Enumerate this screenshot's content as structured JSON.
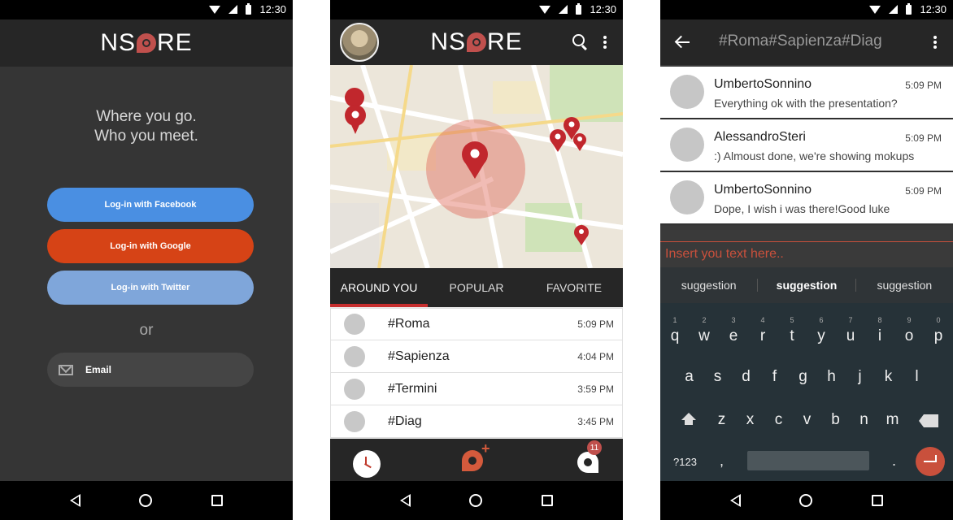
{
  "status": {
    "time": "12:30"
  },
  "brand": {
    "logo_left": "NS",
    "logo_right": "RE"
  },
  "screen1": {
    "tagline_1": "Where you go.",
    "tagline_2": "Who you meet.",
    "facebook_label": "Log-in with Facebook",
    "google_label": "Log-in with Google",
    "twitter_label": "Log-in with Twitter",
    "or_label": "or",
    "email_label": "Email"
  },
  "screen2": {
    "tabs": [
      {
        "label": "AROUND YOU",
        "active": true
      },
      {
        "label": "POPULAR",
        "active": false
      },
      {
        "label": "FAVORITE",
        "active": false
      }
    ],
    "tags": [
      {
        "name": "#Roma",
        "time": "5:09 PM"
      },
      {
        "name": "#Sapienza",
        "time": "4:04 PM"
      },
      {
        "name": "#Termini",
        "time": "3:59 PM"
      },
      {
        "name": "#Diag",
        "time": "3:45 PM"
      }
    ],
    "badge_count": "11"
  },
  "screen3": {
    "title": "#Roma#Sapienza#Diag",
    "messages": [
      {
        "user": "UmbertoSonnino",
        "time": "5:09 PM",
        "text": "Everything ok with the presentation?"
      },
      {
        "user": "AlessandroSteri",
        "time": "5:09 PM",
        "text": ":) Almoust done, we're showing mokups"
      },
      {
        "user": "UmbertoSonnino",
        "time": "5:09 PM",
        "text": "Dope, I wish i was there!Good luke"
      }
    ],
    "input_placeholder": "Insert you text here..",
    "suggestions": [
      "suggestion",
      "suggestion",
      "suggestion"
    ],
    "keys_row1": [
      "q",
      "w",
      "e",
      "r",
      "t",
      "y",
      "u",
      "i",
      "o",
      "p"
    ],
    "keys_row1_hints": [
      "1",
      "2",
      "3",
      "4",
      "5",
      "6",
      "7",
      "8",
      "9",
      "0"
    ],
    "keys_row2": [
      "a",
      "s",
      "d",
      "f",
      "g",
      "h",
      "j",
      "k",
      "l"
    ],
    "keys_row3": [
      "z",
      "x",
      "c",
      "v",
      "b",
      "n",
      "m"
    ],
    "sym_label": "?123",
    "comma": ",",
    "period": "."
  },
  "colors": {
    "accent": "#c62e2e",
    "facebook": "#4a8fe2",
    "google": "#d64316",
    "twitter": "#7fa6da",
    "bar": "#262626"
  }
}
